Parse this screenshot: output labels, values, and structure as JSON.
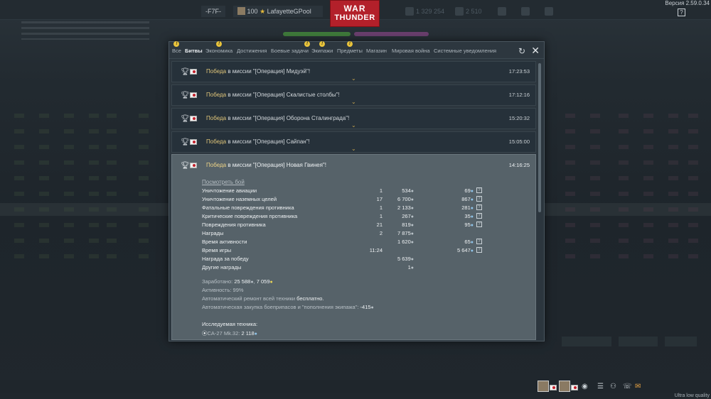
{
  "topbar": {
    "tag": "-F7F-",
    "rank": "100",
    "player": "LafayetteGPool",
    "lions": "1 329 254",
    "eagles": "2 510",
    "version": "Версия 2.59.0.34",
    "help": "?"
  },
  "logo": {
    "line1": "WAR",
    "line2": "THUNDER"
  },
  "tabs": [
    {
      "label": "Все",
      "notify": true
    },
    {
      "label": "Битвы",
      "active": true
    },
    {
      "label": "Экономика",
      "notify": true
    },
    {
      "label": "Достижения"
    },
    {
      "label": "Боевые задачи",
      "notify": true
    },
    {
      "label": "Экипажи",
      "notify": true
    },
    {
      "label": "Предметы",
      "notify": true
    },
    {
      "label": "Магазин"
    },
    {
      "label": "Мировая война"
    },
    {
      "label": "Системные уведомления"
    }
  ],
  "win_word": "Победа",
  "messages": [
    {
      "text": " в миссии \"[Операция] Мидуэй\"!",
      "time": "17:23:53"
    },
    {
      "text": " в миссии \"[Операция] Скалистые столбы\"!",
      "time": "17:12:16"
    },
    {
      "text": " в миссии \"[Операция] Оборона Сталинграда\"!",
      "time": "15:20:32"
    },
    {
      "text": " в миссии \"[Операция] Сайпан\"!",
      "time": "15:05:00"
    }
  ],
  "expanded": {
    "text": " в миссии \"[Операция] Новая Гвинея\"!",
    "time": "14:16:25",
    "watch": "Посмотреть бой",
    "stats": [
      {
        "label": "Уничтожение авиации",
        "count": "1",
        "lions": "534",
        "rp": "69"
      },
      {
        "label": "Уничтожение наземных целей",
        "count": "17",
        "lions": "6 700",
        "rp": "867"
      },
      {
        "label": "Фатальные повреждения противника",
        "count": "1",
        "lions": "2 133",
        "rp": "281"
      },
      {
        "label": "Критические повреждения противника",
        "count": "1",
        "lions": "267",
        "rp": "35"
      },
      {
        "label": "Повреждения противника",
        "count": "21",
        "lions": "819",
        "rp": "95"
      },
      {
        "label": "Награды",
        "count": "2",
        "lions": "7 875",
        "rp": ""
      },
      {
        "label": "Время активности",
        "count": "",
        "lions": "1 620",
        "rp": "65"
      },
      {
        "label": "Время игры",
        "count": "11:24",
        "lions": "",
        "rp": "5 647"
      },
      {
        "label": "Награда за победу",
        "count": "",
        "lions": "5 639",
        "rp": ""
      },
      {
        "label": "Другие награды",
        "count": "",
        "lions": "1",
        "rp": ""
      }
    ],
    "earned_label": "Заработано:",
    "earned_lions": "25 588",
    "earned_rp": "7 059",
    "activity": "Активность: 99%",
    "repair_prefix": "Автоматический ремонт всей техники ",
    "repair_value": "бесплатно.",
    "purchase_prefix": "Автоматическая закупка боеприпасов и \"пополнения экипажа\": ",
    "purchase_value": "-415",
    "research_title": "Исследуемая техника:",
    "vehicle": "CA-27 Mk.32:",
    "vehicle_rp": "2 118"
  },
  "quality": "Ultra low quality"
}
